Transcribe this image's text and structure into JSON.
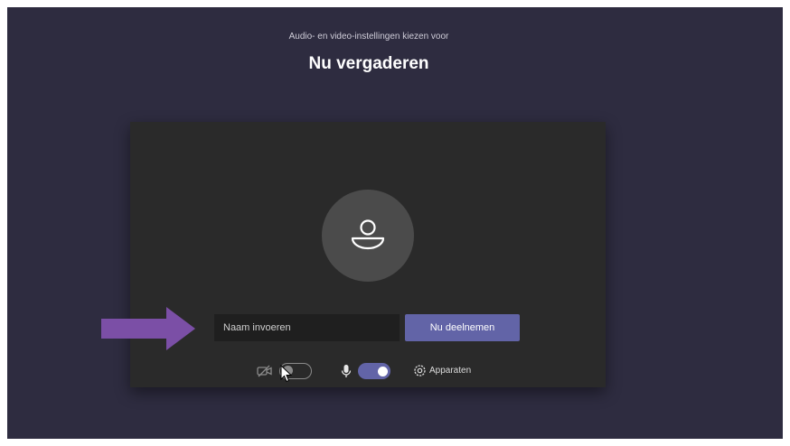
{
  "header": {
    "subtitle": "Audio- en video-instellingen kiezen voor",
    "title": "Nu vergaderen"
  },
  "join": {
    "name_placeholder": "Naam invoeren",
    "join_label": "Nu deelnemen"
  },
  "controls": {
    "camera": {
      "icon": "camera-off-icon",
      "enabled": false
    },
    "microphone": {
      "icon": "microphone-icon",
      "enabled": true
    },
    "devices": {
      "icon": "gear-icon",
      "label": "Apparaten"
    }
  },
  "annotation": {
    "arrow_color": "#7b4fa6"
  },
  "colors": {
    "background": "#2e2c40",
    "preview": "#2a2a2a",
    "accent": "#6264a7"
  }
}
